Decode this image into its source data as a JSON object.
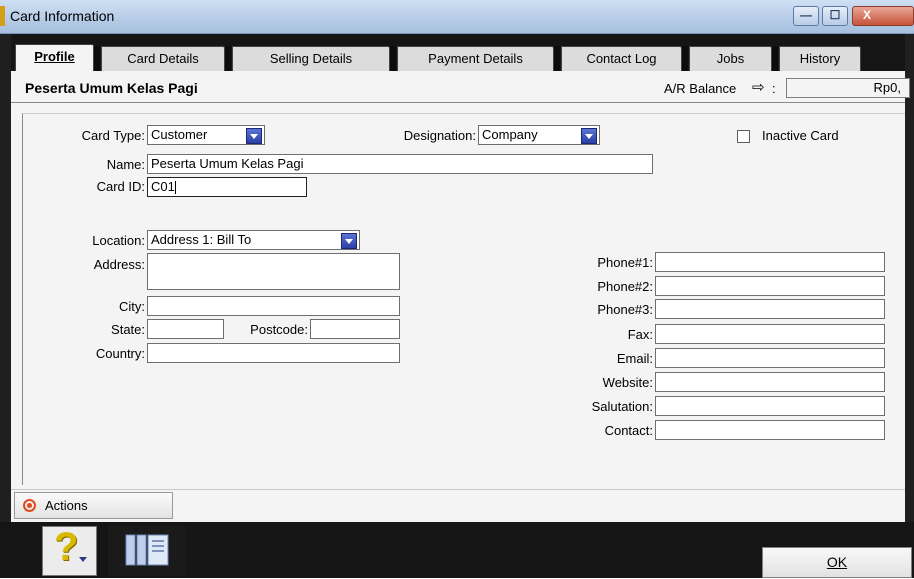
{
  "window": {
    "title": "Card Information",
    "minimize_glyph": "—",
    "maximize_glyph": "☐",
    "close_glyph": "X"
  },
  "tabs": [
    {
      "label": "Profile",
      "active": true
    },
    {
      "label": "Card Details"
    },
    {
      "label": "Selling Details"
    },
    {
      "label": "Payment Details"
    },
    {
      "label": "Contact Log"
    },
    {
      "label": "Jobs"
    },
    {
      "label": "History"
    }
  ],
  "header": {
    "card_name": "Peserta Umum Kelas Pagi",
    "ar_balance_label": "A/R Balance",
    "ar_balance_value": "Rp0,"
  },
  "form": {
    "card_type_label": "Card Type:",
    "card_type_value": "Customer",
    "designation_label": "Designation:",
    "designation_value": "Company",
    "inactive_label": "Inactive Card",
    "name_label": "Name:",
    "name_value": "Peserta Umum Kelas Pagi",
    "card_id_label": "Card ID:",
    "card_id_value": "C01",
    "location_label": "Location:",
    "location_value": "Address 1:  Bill To",
    "address_label": "Address:",
    "city_label": "City:",
    "state_label": "State:",
    "postcode_label": "Postcode:",
    "country_label": "Country:",
    "phone1_label": "Phone#1:",
    "phone2_label": "Phone#2:",
    "phone3_label": "Phone#3:",
    "fax_label": "Fax:",
    "email_label": "Email:",
    "website_label": "Website:",
    "salutation_label": "Salutation:",
    "contact_label": "Contact:"
  },
  "footer": {
    "actions_label": "Actions",
    "ok_label": "OK",
    "help_glyph": "?"
  },
  "colors": {
    "accent_arrow": "#2c3fa4",
    "frame": "#151515",
    "panel": "#f4f4f4",
    "actions_icon": "#e24a1d",
    "help_icon": "#d9b800"
  }
}
